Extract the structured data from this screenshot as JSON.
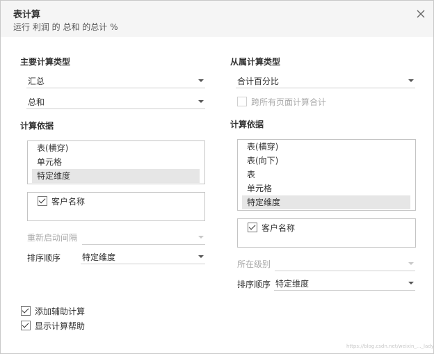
{
  "dialog": {
    "title": "表计算",
    "subtitle": "运行 利润 的 总和 的总计 %"
  },
  "left": {
    "primary_type_label": "主要计算类型",
    "primary_type_value": "汇总",
    "aggregation_value": "总和",
    "compute_using_label": "计算依据",
    "compute_using_items": [
      "表(横穿)",
      "单元格",
      "特定维度"
    ],
    "compute_using_selected": "特定维度",
    "dimensions": [
      {
        "label": "客户名称",
        "checked": true
      }
    ],
    "restart_every_label": "重新启动间隔",
    "restart_every_value": "",
    "sort_order_label": "排序顺序",
    "sort_order_value": "特定维度"
  },
  "right": {
    "secondary_type_label": "从属计算类型",
    "secondary_type_value": "合计百分比",
    "compute_across_all_pages_label": "跨所有页面计算合计",
    "compute_using_label": "计算依据",
    "compute_using_items": [
      "表(横穿)",
      "表(向下)",
      "表",
      "单元格",
      "特定维度"
    ],
    "compute_using_selected": "特定维度",
    "dimensions": [
      {
        "label": "客户名称",
        "checked": true
      }
    ],
    "at_level_label": "所在级别",
    "at_level_value": "",
    "sort_order_label": "排序顺序",
    "sort_order_value": "特定维度"
  },
  "footer": {
    "add_secondary_label": "添加辅助计算",
    "show_help_label": "显示计算帮助"
  },
  "watermark": "https://blog.csdn.net/weixin_..._lady"
}
